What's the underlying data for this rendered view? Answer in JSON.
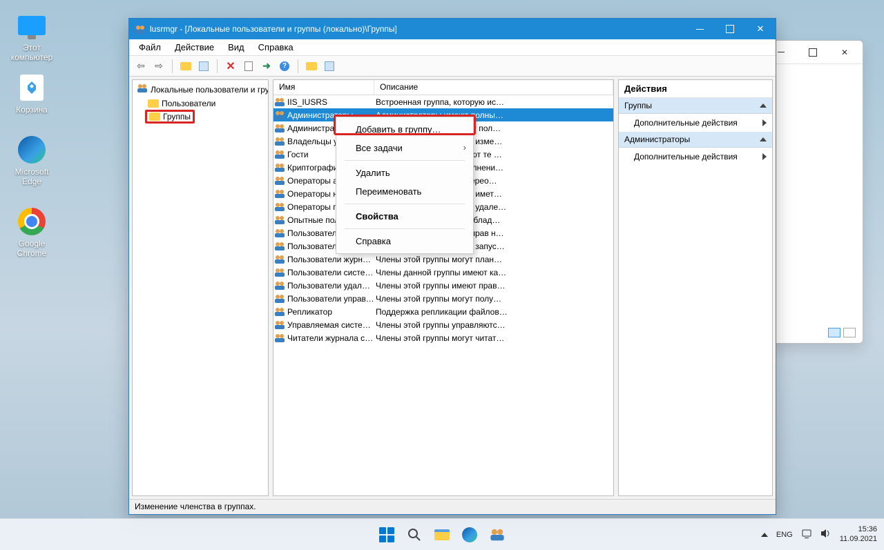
{
  "desktop": {
    "this_pc": "Этот\nкомпьютер",
    "recycle": "Корзина",
    "edge": "Microsoft\nEdge",
    "chrome": "Google\nChrome"
  },
  "bg_window": {},
  "window": {
    "title": "lusrmgr - [Локальные пользователи и группы (локально)\\Группы]",
    "menu": {
      "file": "Файл",
      "action": "Действие",
      "view": "Вид",
      "help": "Справка"
    },
    "status": "Изменение членства в группах."
  },
  "tree": {
    "root": "Локальные пользователи и гру",
    "users": "Пользователи",
    "groups": "Группы"
  },
  "columns": {
    "name": "Имя",
    "desc": "Описание"
  },
  "rows": [
    {
      "name": "IIS_IUSRS",
      "desc": "Встроенная группа, которую ис…"
    },
    {
      "name": "Администраторы",
      "desc": "Администраторы имеют полны…",
      "selected": true
    },
    {
      "name": "Администраторы Hyper-V",
      "desc": "Члены этой группы имеют пол…"
    },
    {
      "name": "Владельцы устройств",
      "desc": "Члены этой группы могут изме…"
    },
    {
      "name": "Гости",
      "desc": "Гости по умолчанию имеют те …"
    },
    {
      "name": "Криптографические операторы",
      "desc": "Членам разрешено выполнени…"
    },
    {
      "name": "Операторы архива",
      "desc": "Участники этой группы перео…"
    },
    {
      "name": "Операторы настройки сети",
      "desc": "Члены этой группы могут имет…"
    },
    {
      "name": "Операторы помощи",
      "desc": "Члены этой группы могут удале…"
    },
    {
      "name": "Опытные пользователи",
      "desc": "Опытные пользователи облад…"
    },
    {
      "name": "Пользователи",
      "desc": "Пользователи не имеют прав н…"
    },
    {
      "name": "Пользователи DCOM",
      "desc": "Члены этой группы могут запус…"
    },
    {
      "name": "Пользователи журналов производительности",
      "desc": "Члены этой группы могут план…"
    },
    {
      "name": "Пользователи системного монитора",
      "desc": "Члены данной группы имеют ка…"
    },
    {
      "name": "Пользователи удаленного рабочего стола",
      "desc": "Члены этой группы имеют прав…"
    },
    {
      "name": "Пользователи управления",
      "desc": "Члены этой группы могут полу…"
    },
    {
      "name": "Репликатор",
      "desc": "Поддержка репликации файлов…"
    },
    {
      "name": "Управляемая системой",
      "desc": "Члены этой группы управляютс…"
    },
    {
      "name": "Читатели журнала событий",
      "desc": "Члены этой группы могут читат…"
    }
  ],
  "context": {
    "add": "Добавить в группу…",
    "all": "Все задачи",
    "del": "Удалить",
    "ren": "Переименовать",
    "props": "Свойства",
    "help": "Справка"
  },
  "actions": {
    "header": "Действия",
    "sec1": "Группы",
    "more": "Дополнительные действия",
    "sec2": "Администраторы"
  },
  "tray": {
    "lang": "ENG",
    "time": "15:36",
    "date": "11.09.2021"
  }
}
